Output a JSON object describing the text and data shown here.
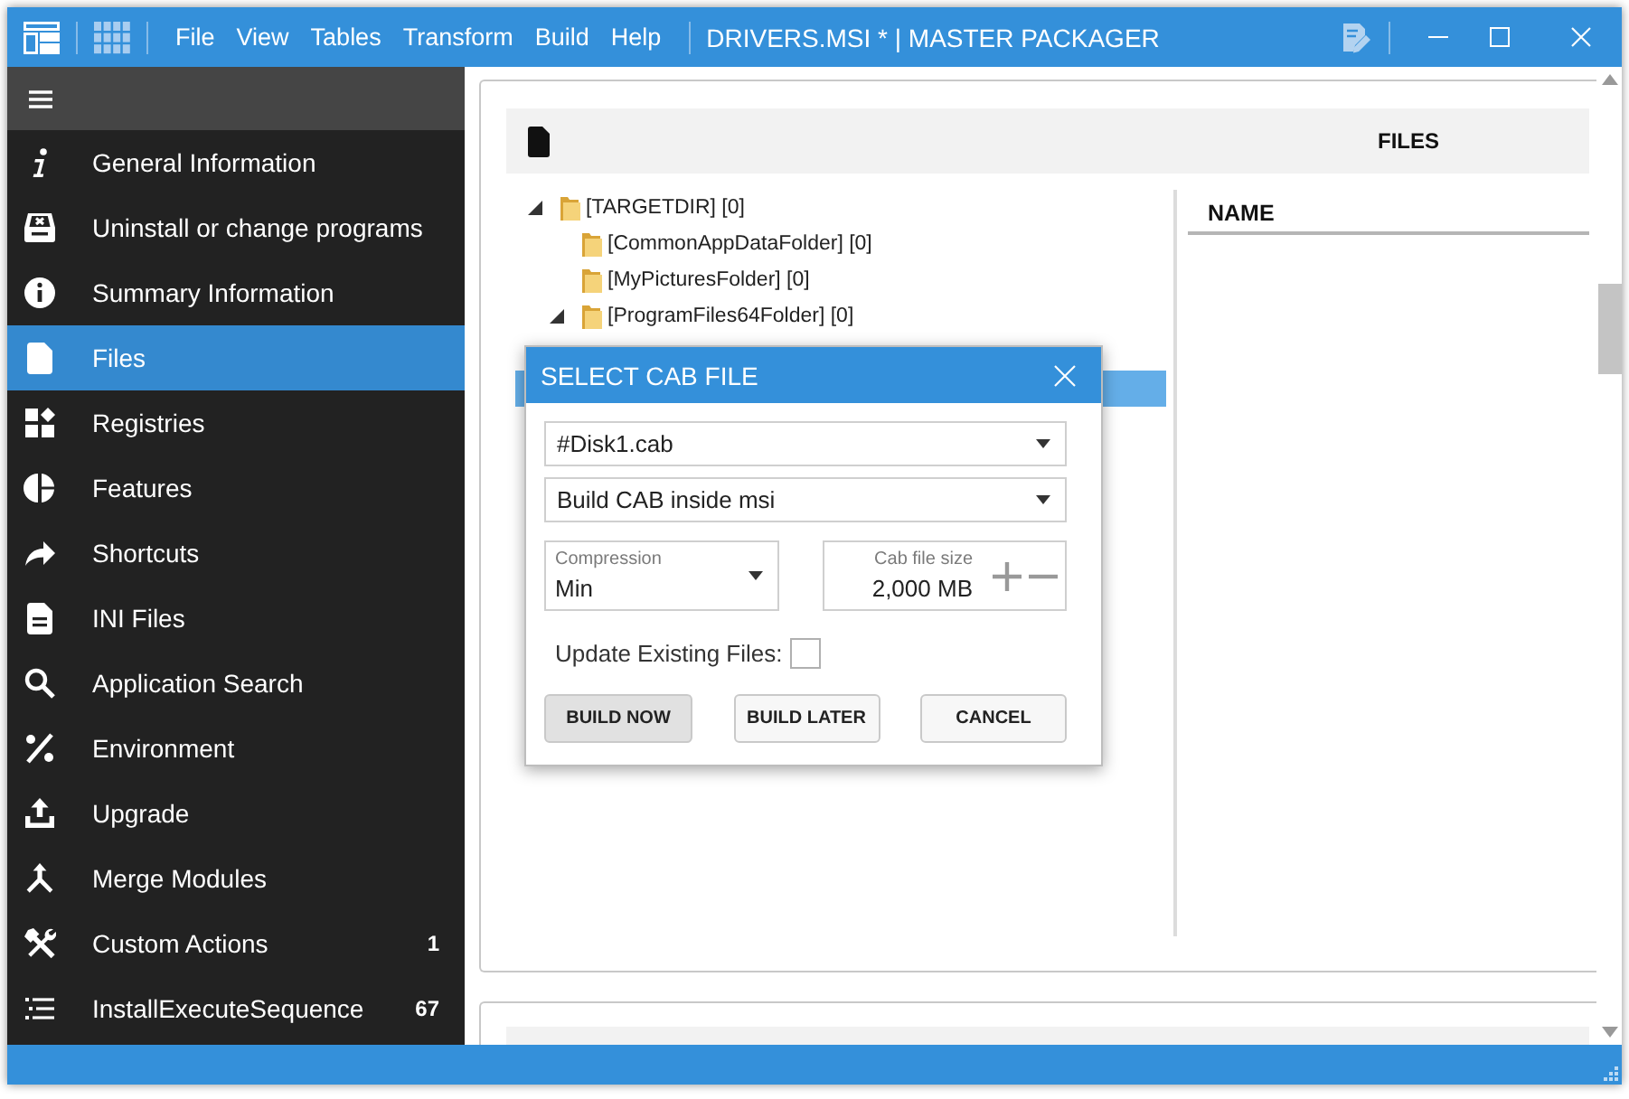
{
  "window": {
    "title": "DRIVERS.MSI * | MASTER PACKAGER",
    "menu": [
      "File",
      "View",
      "Tables",
      "Transform",
      "Build",
      "Help"
    ]
  },
  "sidebar": {
    "items": [
      {
        "label": "General Information",
        "selected": false
      },
      {
        "label": "Uninstall or change programs",
        "selected": false
      },
      {
        "label": "Summary Information",
        "selected": false
      },
      {
        "label": "Files",
        "selected": true
      },
      {
        "label": "Registries",
        "selected": false
      },
      {
        "label": "Features",
        "selected": false
      },
      {
        "label": "Shortcuts",
        "selected": false
      },
      {
        "label": "INI Files",
        "selected": false
      },
      {
        "label": "Application Search",
        "selected": false
      },
      {
        "label": "Environment",
        "selected": false
      },
      {
        "label": "Upgrade",
        "selected": false
      },
      {
        "label": "Merge Modules",
        "selected": false
      },
      {
        "label": "Custom Actions",
        "count": "1",
        "selected": false
      },
      {
        "label": "InstallExecuteSequence",
        "count": "67",
        "selected": false
      }
    ]
  },
  "panel": {
    "title": "FILES",
    "tree": [
      {
        "label": "[TARGETDIR] [0]",
        "expanded": true,
        "selected": false,
        "children": [
          {
            "label": "[CommonAppDataFolder] [0]",
            "selected": false
          },
          {
            "label": "[MyPicturesFolder] [0]",
            "selected": false
          },
          {
            "label": "[ProgramFiles64Folder] [0]",
            "expanded": true,
            "selected": false,
            "children": [
              {
                "selected": false
              },
              {
                "selected": true
              }
            ]
          }
        ]
      }
    ],
    "columns": [
      "NAME"
    ]
  },
  "dialog": {
    "title": "SELECT CAB FILE",
    "cab_file": {
      "value": "#Disk1.cab"
    },
    "build_mode": {
      "value": "Build CAB inside msi"
    },
    "compression": {
      "label": "Compression",
      "value": "Min"
    },
    "cab_file_size": {
      "label": "Cab file size",
      "value": "2,000 MB"
    },
    "update_existing": {
      "label": "Update Existing Files:",
      "checked": false
    },
    "buttons": [
      {
        "label": "BUILD NOW",
        "focused": true
      },
      {
        "label": "BUILD LATER",
        "focused": false
      },
      {
        "label": "CANCEL",
        "focused": false
      }
    ]
  }
}
